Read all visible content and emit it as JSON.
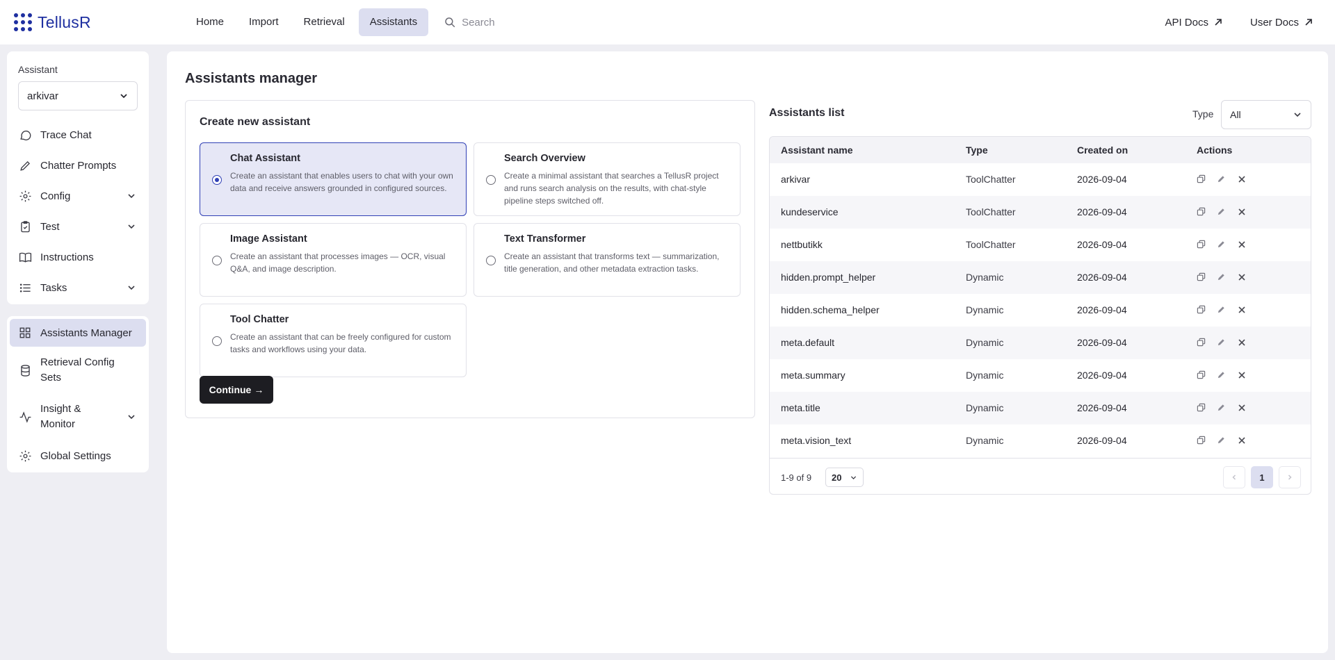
{
  "app": {
    "name": "TellusR"
  },
  "nav": {
    "items": [
      {
        "label": "Home",
        "active": false
      },
      {
        "label": "Import",
        "active": false
      },
      {
        "label": "Retrieval",
        "active": false
      },
      {
        "label": "Assistants",
        "active": true
      }
    ],
    "search_placeholder": "Search",
    "links": [
      {
        "label": "API Docs"
      },
      {
        "label": "User Docs"
      }
    ]
  },
  "sidebar": {
    "assistant_label": "Assistant",
    "assistant_value": "arkivar",
    "items": [
      {
        "label": "Trace Chat",
        "icon": "chat-bubble-icon",
        "expandable": false
      },
      {
        "label": "Chatter Prompts",
        "icon": "pencil-icon",
        "expandable": false
      },
      {
        "label": "Config",
        "icon": "gear-icon",
        "expandable": true
      },
      {
        "label": "Test",
        "icon": "clipboard-icon",
        "expandable": true
      },
      {
        "label": "Instructions",
        "icon": "book-icon",
        "expandable": false
      },
      {
        "label": "Tasks",
        "icon": "list-icon",
        "expandable": true
      }
    ],
    "admin_items": [
      {
        "label": "Assistants Manager",
        "icon": "grid-icon",
        "expandable": false,
        "active": true
      },
      {
        "label": "Retrieval Config Sets",
        "icon": "database-icon",
        "expandable": false
      },
      {
        "label": "Insight & Monitor",
        "icon": "pulse-icon",
        "expandable": true
      },
      {
        "label": "Global Settings",
        "icon": "gear-icon",
        "expandable": false
      }
    ]
  },
  "main": {
    "title": "Assistants manager",
    "create": {
      "title": "Create new assistant",
      "options": [
        {
          "title": "Chat Assistant",
          "description": "Create an assistant that enables users to chat with your own data and receive answers grounded in configured sources.",
          "selected": true
        },
        {
          "title": "Search Overview",
          "description": "Create a minimal assistant that searches a TellusR project and runs search analysis on the results, with chat-style pipeline steps switched off.",
          "selected": false
        },
        {
          "title": "Image Assistant",
          "description": "Create an assistant that processes images — OCR, visual Q&A, and image description.",
          "selected": false
        },
        {
          "title": "Text Transformer",
          "description": "Create an assistant that transforms text — summarization, title generation, and other metadata extraction tasks.",
          "selected": false
        },
        {
          "title": "Tool Chatter",
          "description": "Create an assistant that can be freely configured for custom tasks and workflows using your data.",
          "selected": false
        }
      ],
      "continue_label": "Continue",
      "continue_arrow": "→"
    },
    "list": {
      "title": "Assistants list",
      "type_label": "Type",
      "type_value": "All",
      "columns": [
        "Assistant name",
        "Type",
        "Created on",
        "Actions"
      ],
      "rows": [
        {
          "name": "arkivar",
          "type": "ToolChatter",
          "created": "2026-09-04"
        },
        {
          "name": "kundeservice",
          "type": "ToolChatter",
          "created": "2026-09-04"
        },
        {
          "name": "nettbutikk",
          "type": "ToolChatter",
          "created": "2026-09-04"
        },
        {
          "name": "hidden.prompt_helper",
          "type": "Dynamic",
          "created": "2026-09-04"
        },
        {
          "name": "hidden.schema_helper",
          "type": "Dynamic",
          "created": "2026-09-04"
        },
        {
          "name": "meta.default",
          "type": "Dynamic",
          "created": "2026-09-04"
        },
        {
          "name": "meta.summary",
          "type": "Dynamic",
          "created": "2026-09-04"
        },
        {
          "name": "meta.title",
          "type": "Dynamic",
          "created": "2026-09-04"
        },
        {
          "name": "meta.vision_text",
          "type": "Dynamic",
          "created": "2026-09-04"
        }
      ],
      "row_actions": [
        "copy-icon",
        "edit-icon",
        "delete-icon"
      ],
      "footer": {
        "range": "1-9 of 9",
        "page_size": "20",
        "current_page": "1"
      }
    }
  },
  "colors": {
    "brand": "#1e2fa0",
    "accent": "#2f3fb5",
    "active_bg": "#dcdef0",
    "primary_button": "#1d1d22",
    "background": "#eeeef3"
  }
}
